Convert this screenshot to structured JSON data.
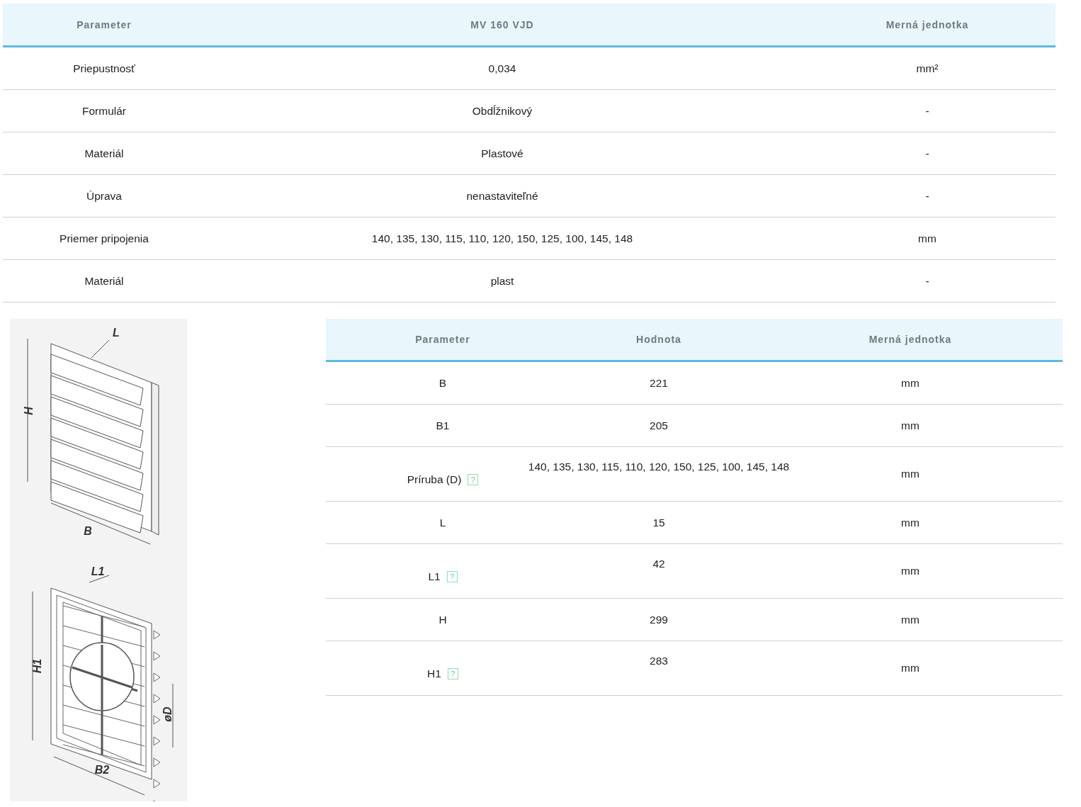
{
  "main_table": {
    "columns": [
      "Parameter",
      "MV 160 VJD",
      "Merná jednotka"
    ],
    "rows": [
      {
        "cells": [
          "Priepustnosť",
          "0,034",
          "mm²"
        ]
      },
      {
        "cells": [
          "Formulár",
          "Obdĺžnikový",
          "-"
        ]
      },
      {
        "cells": [
          "Materiál",
          "Plastové",
          "-"
        ]
      },
      {
        "cells": [
          "Úprava",
          "nenastaviteľné",
          "-"
        ]
      },
      {
        "cells": [
          "Priemer pripojenia",
          "140, 135, 130, 115, 110, 120, 150, 125, 100, 145, 148",
          "mm"
        ]
      },
      {
        "cells": [
          "Materiál",
          "plast",
          "-"
        ]
      }
    ]
  },
  "drawing": {
    "labels": [
      "H",
      "L",
      "B",
      "L1",
      "H1",
      "øD",
      "B2"
    ]
  },
  "dimensions_table": {
    "columns": [
      "Parameter",
      "Hodnota",
      "Merná jednotka"
    ],
    "rows": [
      {
        "cells": [
          "B",
          "221",
          "mm"
        ]
      },
      {
        "cells": [
          "B1",
          "205",
          "mm"
        ]
      },
      {
        "cells": [
          "Príruba (D)",
          "140, 135, 130, 115, 110, 120, 150, 125, 100, 145, 148",
          "mm"
        ],
        "hint": "?"
      },
      {
        "cells": [
          "L",
          "15",
          "mm"
        ]
      },
      {
        "cells": [
          "L1",
          "42",
          "mm"
        ],
        "hint": "?"
      },
      {
        "cells": [
          "H",
          "299",
          "mm"
        ]
      },
      {
        "cells": [
          "H1",
          "283",
          "mm"
        ],
        "hint": "?"
      }
    ]
  }
}
